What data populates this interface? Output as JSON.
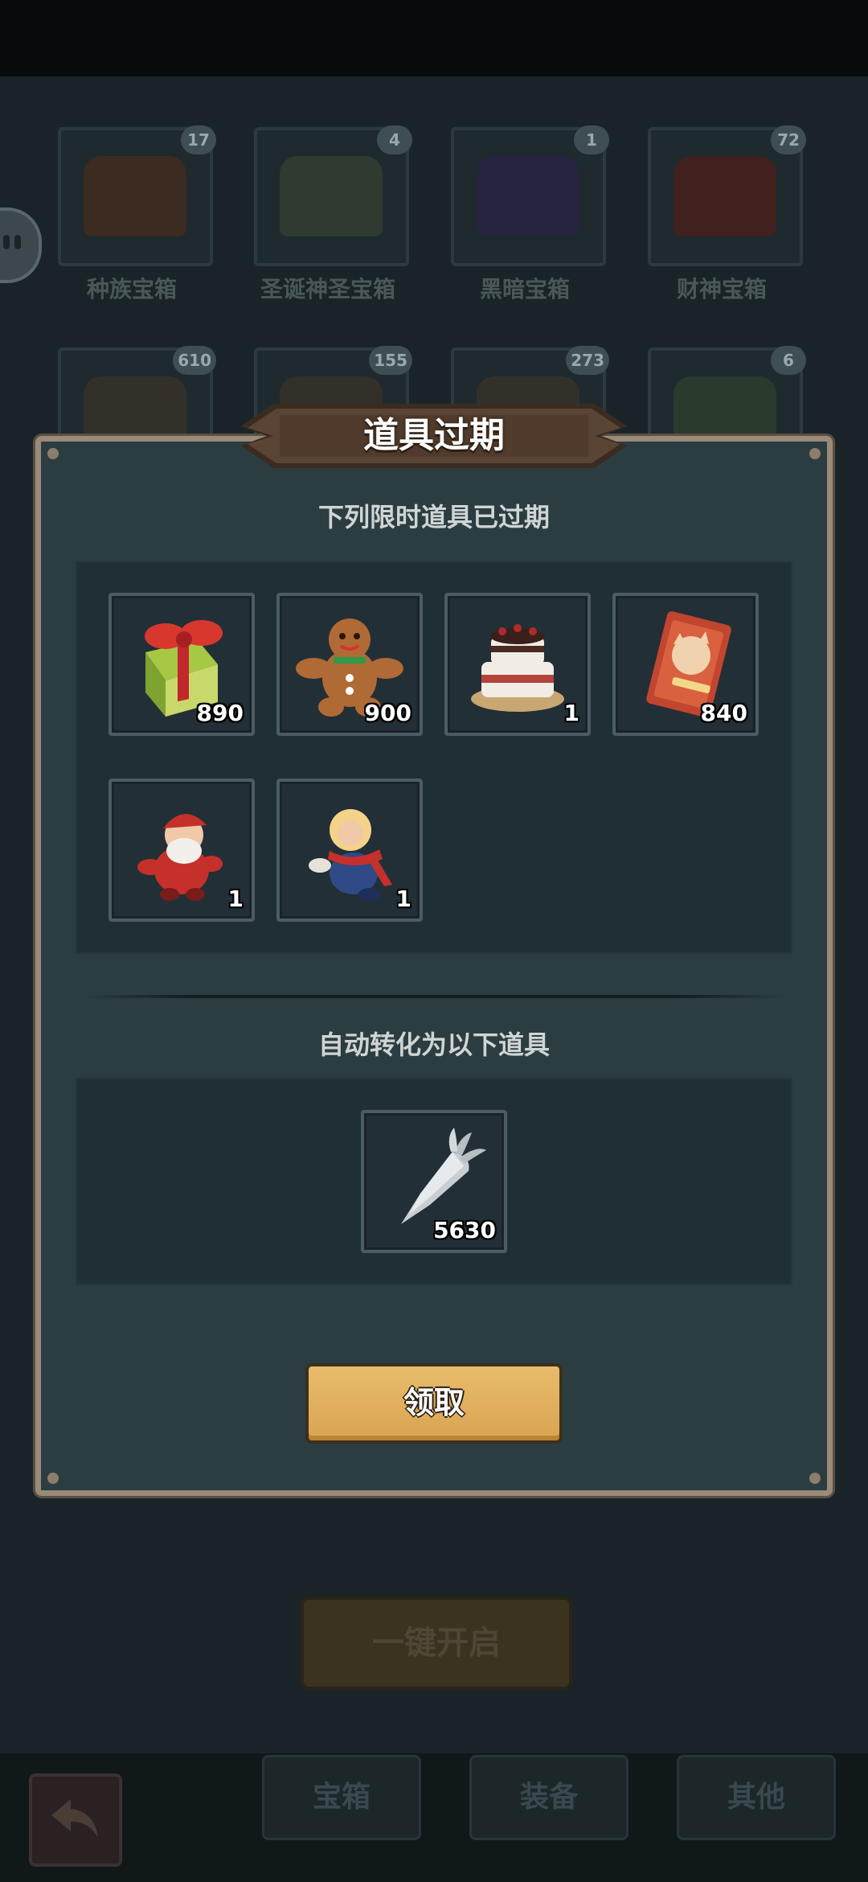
{
  "background": {
    "chests": [
      {
        "label": "种族宝箱",
        "count": "17"
      },
      {
        "label": "圣诞神圣宝箱",
        "count": "4"
      },
      {
        "label": "黑暗宝箱",
        "count": "1"
      },
      {
        "label": "财神宝箱",
        "count": "72"
      },
      {
        "label": "",
        "count": "610"
      },
      {
        "label": "",
        "count": "155"
      },
      {
        "label": "",
        "count": "273"
      },
      {
        "label": "",
        "count": "6"
      }
    ],
    "open_all_label": "一键开启",
    "bottom_tabs": [
      "宝箱",
      "装备",
      "其他"
    ]
  },
  "dialog": {
    "title": "道具过期",
    "expired_caption": "下列限时道具已过期",
    "expired_items": [
      {
        "icon": "gift-box-icon",
        "qty": "890"
      },
      {
        "icon": "gingerbread-man-icon",
        "qty": "900"
      },
      {
        "icon": "cake-icon",
        "qty": "1"
      },
      {
        "icon": "new-year-card-icon",
        "qty": "840"
      },
      {
        "icon": "santa-doll-icon",
        "qty": "1"
      },
      {
        "icon": "winter-doll-icon",
        "qty": "1"
      }
    ],
    "converted_caption": "自动转化为以下道具",
    "converted_items": [
      {
        "icon": "silver-carrot-icon",
        "qty": "5630"
      }
    ],
    "claim_label": "领取"
  },
  "colors": {
    "dialog_bg": "#2c3d42",
    "dialog_border": "#9a8a78",
    "claim_button": "#e2b05e",
    "title_banner": "#5a4433"
  }
}
